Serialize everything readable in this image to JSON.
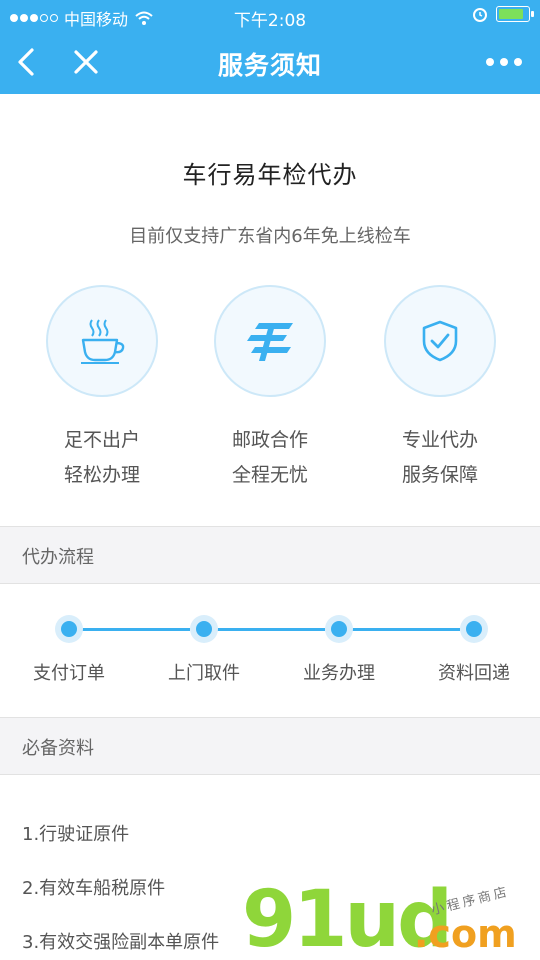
{
  "status_bar": {
    "carrier": "中国移动",
    "time": "下午2:08",
    "battery_level": 0.85,
    "battery_color": "#7de05a"
  },
  "nav": {
    "title": "服务须知",
    "back_icon": "chevron-left-icon",
    "close_icon": "close-icon",
    "more_icon": "more-dots-icon"
  },
  "main": {
    "title": "车行易年检代办",
    "subtitle": "目前仅支持广东省内6年免上线检车"
  },
  "features": [
    {
      "icon": "coffee-cup-icon",
      "line1": "足不出户",
      "line2": "轻松办理"
    },
    {
      "icon": "china-post-icon",
      "line1": "邮政合作",
      "line2": "全程无忧"
    },
    {
      "icon": "shield-check-icon",
      "line1": "专业代办",
      "line2": "服务保障"
    }
  ],
  "process": {
    "header": "代办流程",
    "steps": [
      "支付订单",
      "上门取件",
      "业务办理",
      "资料回递"
    ]
  },
  "documents": {
    "header": "必备资料",
    "items": [
      "1.行驶证原件",
      "2.有效车船税原件",
      "3.有效交强险副本单原件"
    ]
  },
  "watermark": {
    "big": "91ud",
    "domain": ".com",
    "small": "小程序商店"
  },
  "colors": {
    "brand_blue": "#3ab0f0",
    "section_bg": "#f4f4f6"
  }
}
